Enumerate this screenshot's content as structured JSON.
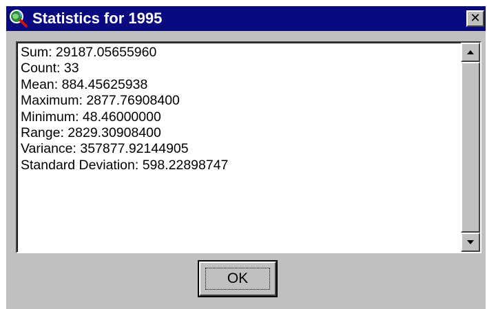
{
  "window": {
    "title": "Statistics for 1995",
    "icon": "globe-magnifier-icon",
    "close_glyph": "✕",
    "colors": {
      "titlebar": "#0a0a80",
      "face": "#c0c0c0"
    }
  },
  "stats": [
    "Sum: 29187.05655960",
    "Count: 33",
    "Mean: 884.45625938",
    "Maximum: 2877.76908400",
    "Minimum: 48.46000000",
    "Range: 2829.30908400",
    "Variance: 357877.92144905",
    "Standard Deviation: 598.22898747"
  ],
  "buttons": {
    "ok_label": "OK"
  }
}
